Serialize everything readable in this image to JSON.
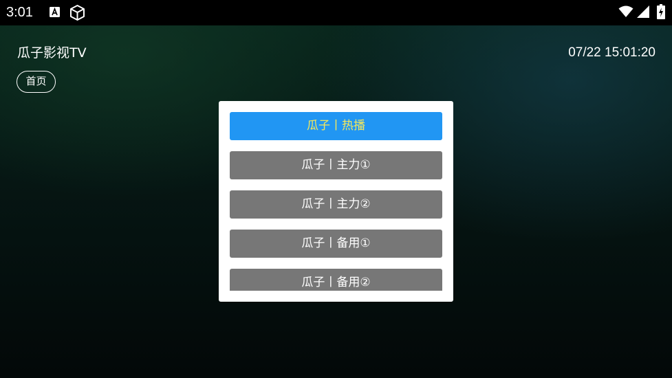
{
  "status_bar": {
    "time": "3:01",
    "icons": [
      "a-notification-icon",
      "cube-icon",
      "wifi-icon",
      "signal-icon",
      "battery-charging-icon"
    ]
  },
  "header": {
    "app_title": "瓜子影视TV",
    "datetime": "07/22 15:01:20"
  },
  "nav": {
    "home_tab": "首页"
  },
  "dialog": {
    "items": [
      {
        "label": "瓜子丨热播",
        "selected": true
      },
      {
        "label": "瓜子丨主力①",
        "selected": false
      },
      {
        "label": "瓜子丨主力②",
        "selected": false
      },
      {
        "label": "瓜子丨备用①",
        "selected": false
      },
      {
        "label": "瓜子丨备用②",
        "selected": false
      }
    ]
  },
  "colors": {
    "selected_bg": "#2196f3",
    "selected_text": "#f6e85a",
    "item_bg": "#777777",
    "dialog_bg": "#ffffff"
  }
}
